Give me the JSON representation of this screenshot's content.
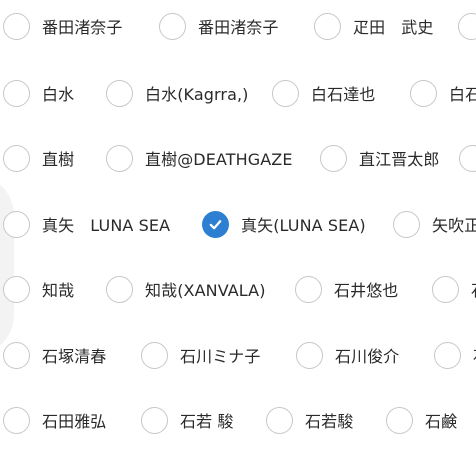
{
  "rows": [
    {
      "options": [
        {
          "label": "番田渚奈子",
          "checked": false
        },
        {
          "label": "番田渚奈子",
          "checked": false
        },
        {
          "label": "疋田　武史",
          "checked": false
        },
        {
          "label": "",
          "checked": false
        }
      ]
    },
    {
      "options": [
        {
          "label": "白水",
          "checked": false
        },
        {
          "label": "白水(Kagrra,)",
          "checked": false
        },
        {
          "label": "白石達也",
          "checked": false
        },
        {
          "label": "白石",
          "checked": false
        }
      ]
    },
    {
      "options": [
        {
          "label": "直樹",
          "checked": false
        },
        {
          "label": "直樹@DEATHGAZE",
          "checked": false
        },
        {
          "label": "直江晋太郎",
          "checked": false
        },
        {
          "label": "",
          "checked": false
        }
      ]
    },
    {
      "options": [
        {
          "label": "真矢　LUNA SEA",
          "checked": false
        },
        {
          "label": "真矢(LUNA SEA)",
          "checked": true
        },
        {
          "label": "矢吹正",
          "checked": false
        }
      ]
    },
    {
      "options": [
        {
          "label": "知哉",
          "checked": false
        },
        {
          "label": "知哉(XANVALA)",
          "checked": false
        },
        {
          "label": "石井悠也",
          "checked": false
        },
        {
          "label": "石",
          "checked": false
        }
      ]
    },
    {
      "options": [
        {
          "label": "石塚清春",
          "checked": false
        },
        {
          "label": "石川ミナ子",
          "checked": false
        },
        {
          "label": "石川俊介",
          "checked": false
        },
        {
          "label": "石",
          "checked": false
        }
      ]
    },
    {
      "options": [
        {
          "label": "石田雅弘",
          "checked": false
        },
        {
          "label": "石若 駿",
          "checked": false
        },
        {
          "label": "石若駿",
          "checked": false
        },
        {
          "label": "石鹸",
          "checked": false
        }
      ]
    }
  ]
}
